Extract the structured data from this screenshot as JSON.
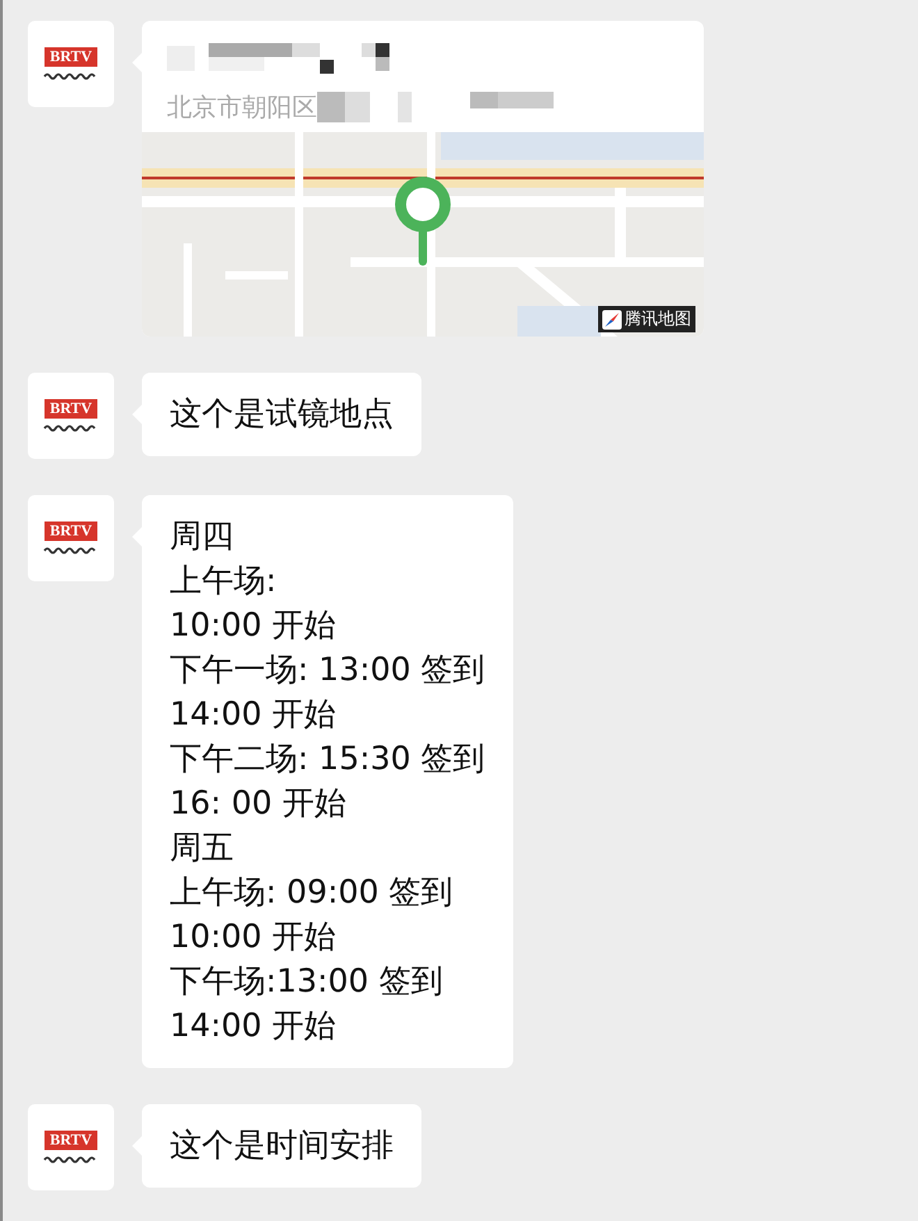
{
  "messages": [
    {
      "kind": "location",
      "avatar": {
        "label": "BRTV"
      },
      "address": "北京市朝阳区",
      "map_attribution": "腾讯地图"
    },
    {
      "kind": "text",
      "avatar": {
        "label": "BRTV"
      },
      "lines": [
        "这个是试镜地点"
      ]
    },
    {
      "kind": "text",
      "avatar": {
        "label": "BRTV"
      },
      "lines": [
        "周四",
        "上午场:",
        "10:00 开始",
        "下午一场: 13:00 签到",
        "14:00 开始",
        "下午二场: 15:30 签到",
        "16: 00 开始",
        "周五",
        "上午场: 09:00 签到",
        "10:00 开始",
        "下午场:13:00 签到",
        "14:00 开始"
      ]
    },
    {
      "kind": "text",
      "avatar": {
        "label": "BRTV"
      },
      "lines": [
        "这个是时间安排"
      ]
    }
  ]
}
